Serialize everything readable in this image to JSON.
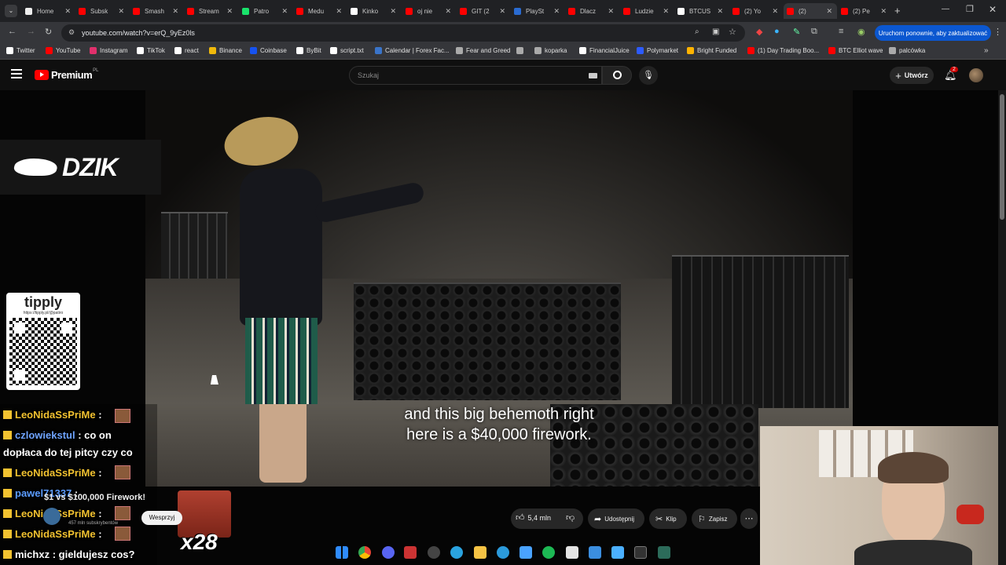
{
  "browser": {
    "tabs": [
      {
        "label": "Home",
        "color": "#eeeeee"
      },
      {
        "label": "Subsk",
        "color": "#ff0000"
      },
      {
        "label": "Smash",
        "color": "#ff0000"
      },
      {
        "label": "Stream",
        "color": "#ff0000"
      },
      {
        "label": "Patro",
        "color": "#19e36b"
      },
      {
        "label": "Medu",
        "color": "#ff0000"
      },
      {
        "label": "Kinko",
        "color": "#ffffff"
      },
      {
        "label": "oj nie",
        "color": "#ff0000"
      },
      {
        "label": "GIT (2",
        "color": "#ff0000"
      },
      {
        "label": "PlaySt",
        "color": "#2a6bd1"
      },
      {
        "label": "Dlacz",
        "color": "#ff0000"
      },
      {
        "label": "Ludzie",
        "color": "#ff0000"
      },
      {
        "label": "BTCUS",
        "color": "#ffffff"
      },
      {
        "label": "(2) Yo",
        "color": "#ff0000"
      },
      {
        "label": "(2)",
        "color": "#ff0000"
      },
      {
        "label": "(2) Pe",
        "color": "#ff0000"
      }
    ],
    "url": "youtube.com/watch?v=erQ_9yEz0ls",
    "update_button": "Uruchom ponownie, aby zaktualizować",
    "bookmarks": [
      {
        "label": "Twitter",
        "color": "#ffffff"
      },
      {
        "label": "YouTube",
        "color": "#ff0000"
      },
      {
        "label": "Instagram",
        "color": "#e1306c"
      },
      {
        "label": "TikTok",
        "color": "#ffffff"
      },
      {
        "label": "react",
        "color": "#ffffff"
      },
      {
        "label": "Binance",
        "color": "#f0b90b"
      },
      {
        "label": "Coinbase",
        "color": "#1652f0"
      },
      {
        "label": "ByBit",
        "color": "#ffffff"
      },
      {
        "label": "script.txt",
        "color": "#ffffff"
      },
      {
        "label": "Calendar | Forex Fac...",
        "color": "#3a74c9"
      },
      {
        "label": "Fear and Greed",
        "color": "#aaaaaa"
      },
      {
        "label": "",
        "color": "#aaaaaa"
      },
      {
        "label": "koparka",
        "color": "#aaaaaa"
      },
      {
        "label": "FinancialJuice",
        "color": "#ffffff"
      },
      {
        "label": "Polymarket",
        "color": "#2d5bff"
      },
      {
        "label": "Bright Funded",
        "color": "#ffb300"
      },
      {
        "label": "(1) Day Trading Boo...",
        "color": "#ff0000"
      },
      {
        "label": "BTC Elliot wave",
        "color": "#ff0000"
      },
      {
        "label": "palcówka",
        "color": "#aaaaaa"
      }
    ]
  },
  "youtube": {
    "logo": "Premium",
    "logo_sup": "PL",
    "search_placeholder": "Szukaj",
    "create_label": "Utwórz",
    "notif_count": "2",
    "subtitle_line1": "and this big behemoth right",
    "subtitle_line2": "here is a $40,000 firework.",
    "video_title": "$1 vs $100,000 Firework!",
    "channel_subs": "457 mln subskrybentów",
    "join_label": "Wesprzyj",
    "likes": "5,4 mln",
    "share_label": "Udostępnij",
    "clip_label": "Klip",
    "save_label": "Zapisz"
  },
  "overlay": {
    "sponsor_logo": "DZIK",
    "tipply_logo": "tipply",
    "tipply_url": "https://tipply.pl/@patiro",
    "emote_multiplier": "x28",
    "chat": [
      {
        "user": "LeoNidaSsPriMe",
        "text": "",
        "color": "#f2c230"
      },
      {
        "user": "czlowiekstul",
        "text": "co on",
        "color": "#6fa4ff"
      },
      {
        "user": "",
        "text": "dopłaca do tej pitcy czy co",
        "color": "#ffffff"
      },
      {
        "user": "LeoNidaSsPriMe",
        "text": "",
        "color": "#f2c230"
      },
      {
        "user": "pawel71337",
        "text": "",
        "color": "#5b9cff"
      },
      {
        "user": "LeoNidaSsPriMe",
        "text": "",
        "color": "#f2c230"
      },
      {
        "user": "LeoNidaSsPriMe",
        "text": "",
        "color": "#f2c230"
      },
      {
        "user": "michxz",
        "text": "gieldujesz cos?",
        "color": "#ffffff"
      }
    ]
  }
}
